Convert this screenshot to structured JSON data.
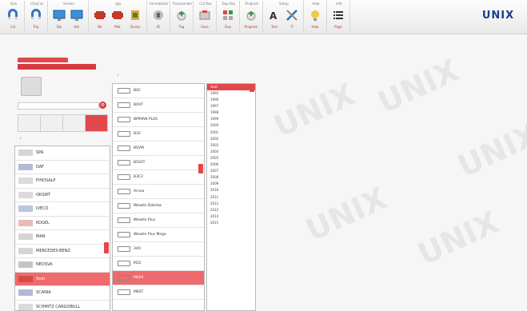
{
  "toolbar": {
    "groups": [
      {
        "title": "Size",
        "buttons": [
          {
            "label": "Cst",
            "icon": "magnet-icon"
          }
        ]
      },
      {
        "title": "ChipCut",
        "buttons": [
          {
            "label": "Trip",
            "icon": "magnet-icon"
          }
        ]
      },
      {
        "title": "Screen",
        "buttons": [
          {
            "label": "Dw",
            "icon": "monitor-icon"
          },
          {
            "label": "Hm",
            "icon": "monitor-icon"
          }
        ]
      },
      {
        "title": "Jigs",
        "buttons": [
          {
            "label": "Wr",
            "icon": "chip-icon"
          },
          {
            "label": "Mot",
            "icon": "chip-icon"
          },
          {
            "label": "Dump",
            "icon": "clamp-icon"
          }
        ]
      },
      {
        "title": "Immobilizer",
        "buttons": [
          {
            "label": "ID",
            "icon": "wrench-icon"
          }
        ]
      },
      {
        "title": "Transponder",
        "buttons": [
          {
            "label": "Tag",
            "icon": "disc-plus-icon"
          }
        ]
      },
      {
        "title": "Cut Key",
        "buttons": [
          {
            "label": "Save",
            "icon": "tray-icon"
          }
        ]
      },
      {
        "title": "Dup Key",
        "buttons": [
          {
            "label": "Dup",
            "icon": "grid-icon"
          }
        ]
      },
      {
        "title": "Program",
        "buttons": [
          {
            "label": "Program",
            "icon": "disc-plus-icon"
          }
        ]
      },
      {
        "title": "Setup",
        "buttons": [
          {
            "label": "Tool",
            "icon": "font-icon"
          },
          {
            "label": "Tl",
            "icon": "tools-icon"
          }
        ]
      },
      {
        "title": "Help",
        "buttons": [
          {
            "label": "Help",
            "icon": "bulb-icon"
          }
        ]
      },
      {
        "title": "Info",
        "buttons": [
          {
            "label": "Page",
            "icon": "list-icon"
          }
        ]
      }
    ],
    "logo": {
      "text": "UNIX",
      "tag": ""
    }
  },
  "left": {
    "section_tab": "",
    "header": "",
    "key_desc": [
      "",
      "",
      ""
    ],
    "search_placeholder": "",
    "mode_tabs": [
      "",
      "",
      "",
      ""
    ],
    "mode_check_label": ""
  },
  "brands": [
    {
      "name": "SPA",
      "color": "#888"
    },
    {
      "name": "DAF",
      "color": "#1d3c8a"
    },
    {
      "name": "FIHDSALP",
      "color": "#999"
    },
    {
      "name": "OKSIRT",
      "color": "#999"
    },
    {
      "name": "IVECO",
      "color": "#3c5aa6"
    },
    {
      "name": "KOGEL",
      "color": "#c0392b"
    },
    {
      "name": "MAN",
      "color": "#888"
    },
    {
      "name": "MERCEDES-BENZ",
      "color": "#888"
    },
    {
      "name": "NEOSVA",
      "color": "#555"
    },
    {
      "name": "Seat",
      "color": "#c0392b",
      "selected": true
    },
    {
      "name": "SCANIA",
      "color": "#1d3c8a"
    },
    {
      "name": "SCHMITZ CARGOBULL",
      "color": "#999"
    }
  ],
  "models": {
    "header_label": "",
    "items": [
      "B0C",
      "BOVT",
      "BIPMAN PLUS",
      "B32",
      "BSVM",
      "B502T",
      "B3C2",
      "Arnea",
      "Wewtin Dateliw",
      "Wewtin Plus",
      "Wewtin Plus Mega",
      "3V0",
      "M32",
      "M604",
      "M6ST"
    ],
    "selected_index": 13
  },
  "years": {
    "header": "Seat",
    "items": [
      "1995",
      "1996",
      "1997",
      "1998",
      "1999",
      "2000",
      "2001",
      "2002",
      "2003",
      "2004",
      "2005",
      "2006",
      "2007",
      "2008",
      "2009",
      "2010",
      "2011",
      "2012",
      "2013",
      "2014",
      "2015"
    ]
  },
  "watermark": "UNIX",
  "colors": {
    "accent": "#d63a3e",
    "selected": "#ef6a6d",
    "brand_blue": "#1d3c8a"
  }
}
